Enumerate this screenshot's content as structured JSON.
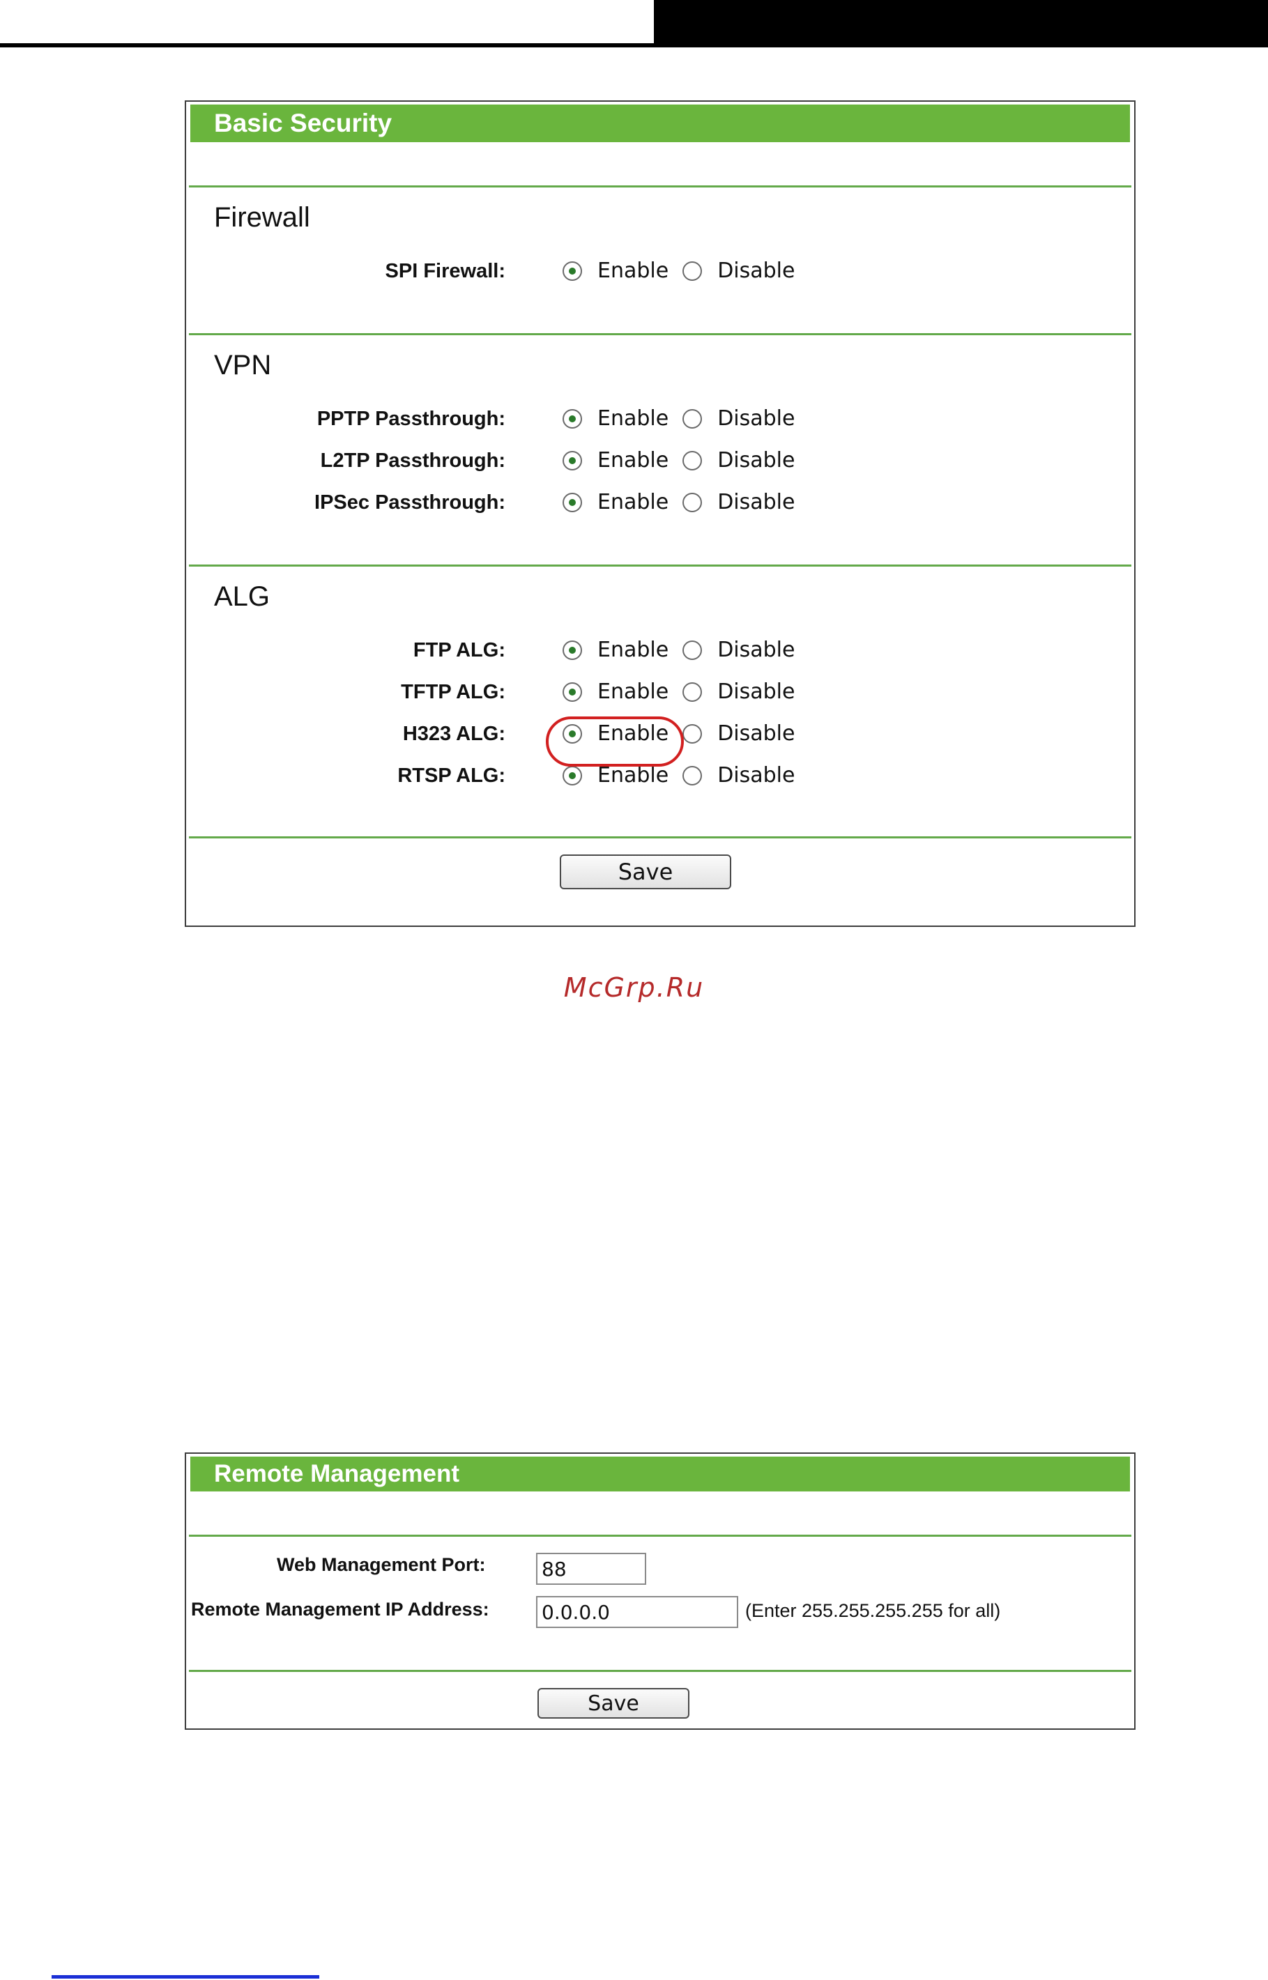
{
  "watermark": "McGrp.Ru",
  "basic_security": {
    "title": "Basic Security",
    "save_label": "Save",
    "option_labels": {
      "enable": "Enable",
      "disable": "Disable"
    },
    "sections": [
      {
        "heading": "Firewall",
        "rows": [
          {
            "label": "SPI Firewall:",
            "value": "Enable"
          }
        ]
      },
      {
        "heading": "VPN",
        "rows": [
          {
            "label": "PPTP Passthrough:",
            "value": "Enable"
          },
          {
            "label": "L2TP Passthrough:",
            "value": "Enable"
          },
          {
            "label": "IPSec Passthrough:",
            "value": "Enable"
          }
        ]
      },
      {
        "heading": "ALG",
        "rows": [
          {
            "label": "FTP ALG:",
            "value": "Enable"
          },
          {
            "label": "TFTP ALG:",
            "value": "Enable"
          },
          {
            "label": "H323 ALG:",
            "value": "Enable"
          },
          {
            "label": "RTSP ALG:",
            "value": "Enable"
          }
        ]
      }
    ]
  },
  "remote_management": {
    "title": "Remote Management",
    "web_port_label": "Web Management Port:",
    "web_port_value": "88",
    "ip_label": "Remote Management IP Address:",
    "ip_value": "0.0.0.0",
    "ip_hint": "(Enter 255.255.255.255 for all)",
    "save_label": "Save"
  }
}
